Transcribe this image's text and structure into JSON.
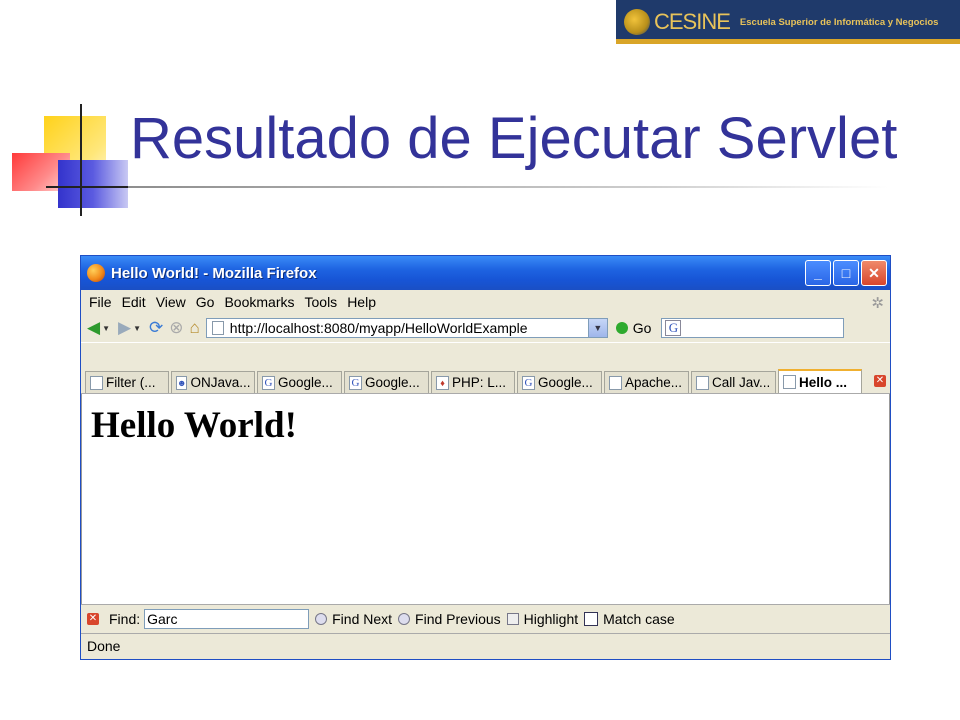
{
  "slide": {
    "title": "Resultado de Ejecutar Servlet"
  },
  "logo": {
    "brand": "CESINE",
    "subtitle": "Escuela Superior de Informática y Negocios"
  },
  "window": {
    "title": "Hello World! - Mozilla Firefox",
    "buttons": {
      "minimize": "_",
      "maximize": "□",
      "close": "✕"
    }
  },
  "menu": [
    "File",
    "Edit",
    "View",
    "Go",
    "Bookmarks",
    "Tools",
    "Help"
  ],
  "nav": {
    "url": "http://localhost:8080/myapp/HelloWorldExample",
    "go_label": "Go",
    "search_value": ""
  },
  "tabs": [
    {
      "label": "Filter (...",
      "icon": "page-icon"
    },
    {
      "label": "ONJava...",
      "icon": "onjava-icon"
    },
    {
      "label": "Google...",
      "icon": "google-icon"
    },
    {
      "label": "Google...",
      "icon": "google-icon"
    },
    {
      "label": "PHP: L...",
      "icon": "php-icon"
    },
    {
      "label": "Google...",
      "icon": "google-icon"
    },
    {
      "label": "Apache...",
      "icon": "page-icon"
    },
    {
      "label": "Call Jav...",
      "icon": "page-icon"
    },
    {
      "label": "Hello ...",
      "icon": "page-icon",
      "active": true
    }
  ],
  "content": {
    "heading": "Hello World!"
  },
  "find": {
    "label": "Find:",
    "value": "Garc",
    "next": "Find Next",
    "previous": "Find Previous",
    "highlight": "Highlight",
    "match_case": "Match case",
    "match_case_checked": false
  },
  "status": {
    "text": "Done"
  },
  "colors": {
    "title_text": "#333399",
    "titlebar": "#1e63e1",
    "chrome": "#ece9d8"
  }
}
